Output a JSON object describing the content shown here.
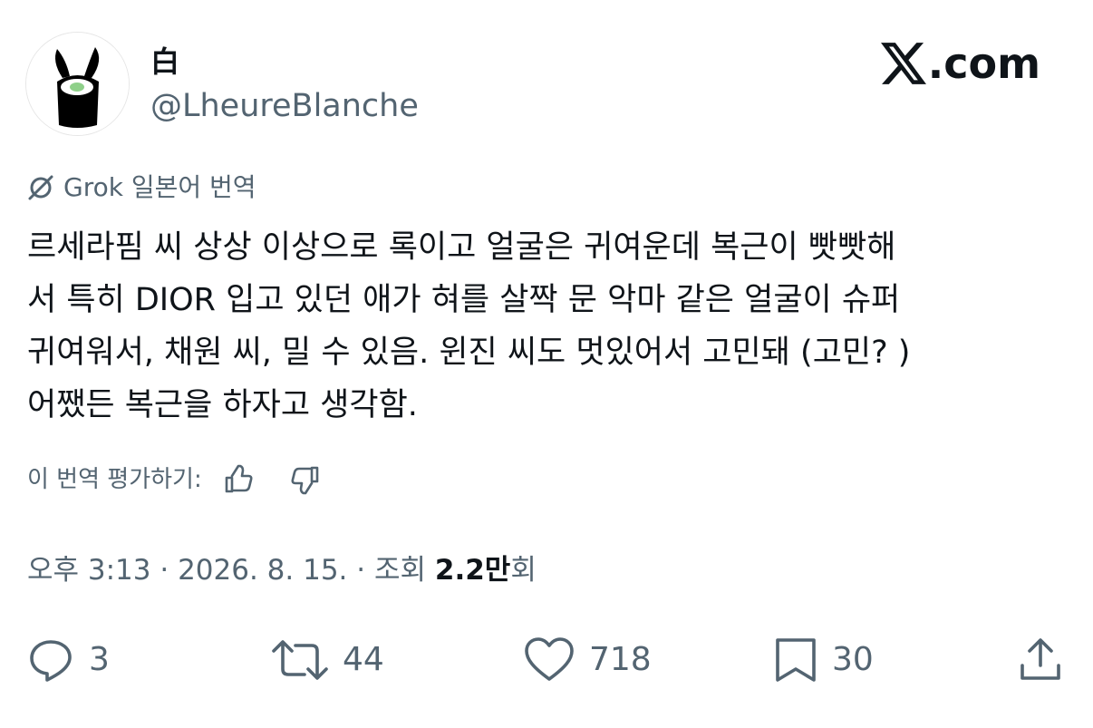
{
  "header": {
    "display_name": "白",
    "handle": "@LheureBlanche",
    "brand_x": "𝕏",
    "brand_suffix": ".com"
  },
  "translation": {
    "label": "Grok 일본어 번역"
  },
  "tweet": {
    "lines": [
      "르세라핌 씨 상상 이상으로 록이고 얼굴은 귀여운데 복근이 빳빳해",
      "서 특히 DIOR 입고 있던 애가 혀를 살짝 문 악마 같은 얼굴이 슈퍼",
      "귀여워서, 채원 씨, 밀 수 있음. 윈진 씨도 멋있어서 고민돼 (고민? )",
      "어쨌든 복근을 하자고 생각함."
    ]
  },
  "rate": {
    "label": "이 번역 평가하기:"
  },
  "meta": {
    "time": "오후 3:13",
    "sep1": " · ",
    "date": "2026. 8. 15.",
    "sep2": " · ",
    "views_prefix": "조회 ",
    "views_value": "2.2만",
    "views_suffix": "회"
  },
  "actions": {
    "replies": "3",
    "reposts": "44",
    "likes": "718",
    "bookmarks": "30"
  },
  "icons": {
    "reply": "reply-icon",
    "repost": "repost-icon",
    "like": "heart-icon",
    "bookmark": "bookmark-icon",
    "share": "share-icon",
    "grok": "grok-icon",
    "thumbs_up": "thumbs-up-icon",
    "thumbs_down": "thumbs-down-icon"
  },
  "colors": {
    "text": "#0f1419",
    "secondary": "#536471",
    "background": "#ffffff"
  }
}
